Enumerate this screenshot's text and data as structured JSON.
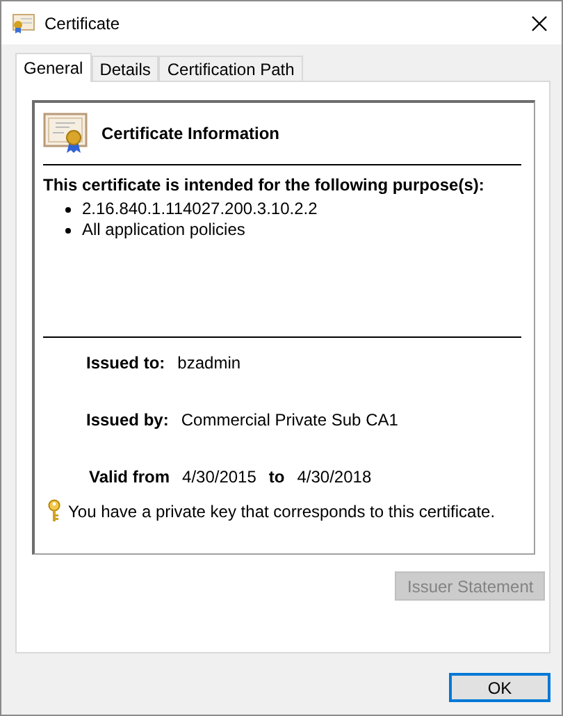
{
  "window": {
    "title": "Certificate"
  },
  "tabs": [
    {
      "label": "General",
      "selected": true
    },
    {
      "label": "Details",
      "selected": false
    },
    {
      "label": "Certification Path",
      "selected": false
    }
  ],
  "info": {
    "heading": "Certificate Information",
    "purpose_title": "This certificate is intended for the following purpose(s):",
    "purposes": [
      "2.16.840.1.114027.200.3.10.2.2",
      "All application policies"
    ],
    "issued_to": {
      "label": "Issued to:",
      "value": "bzadmin"
    },
    "issued_by": {
      "label": "Issued by:",
      "value": "Commercial Private Sub CA1"
    },
    "validity": {
      "label": "Valid from",
      "from": "4/30/2015",
      "to_label": "to",
      "to": "4/30/2018"
    },
    "key_note": "You have a private key that corresponds to this certificate."
  },
  "buttons": [
    {
      "label": "Issuer Statement",
      "kind": "panel",
      "disabled": true,
      "default": false
    },
    {
      "label": "OK",
      "kind": "footer",
      "disabled": false,
      "default": true
    }
  ]
}
